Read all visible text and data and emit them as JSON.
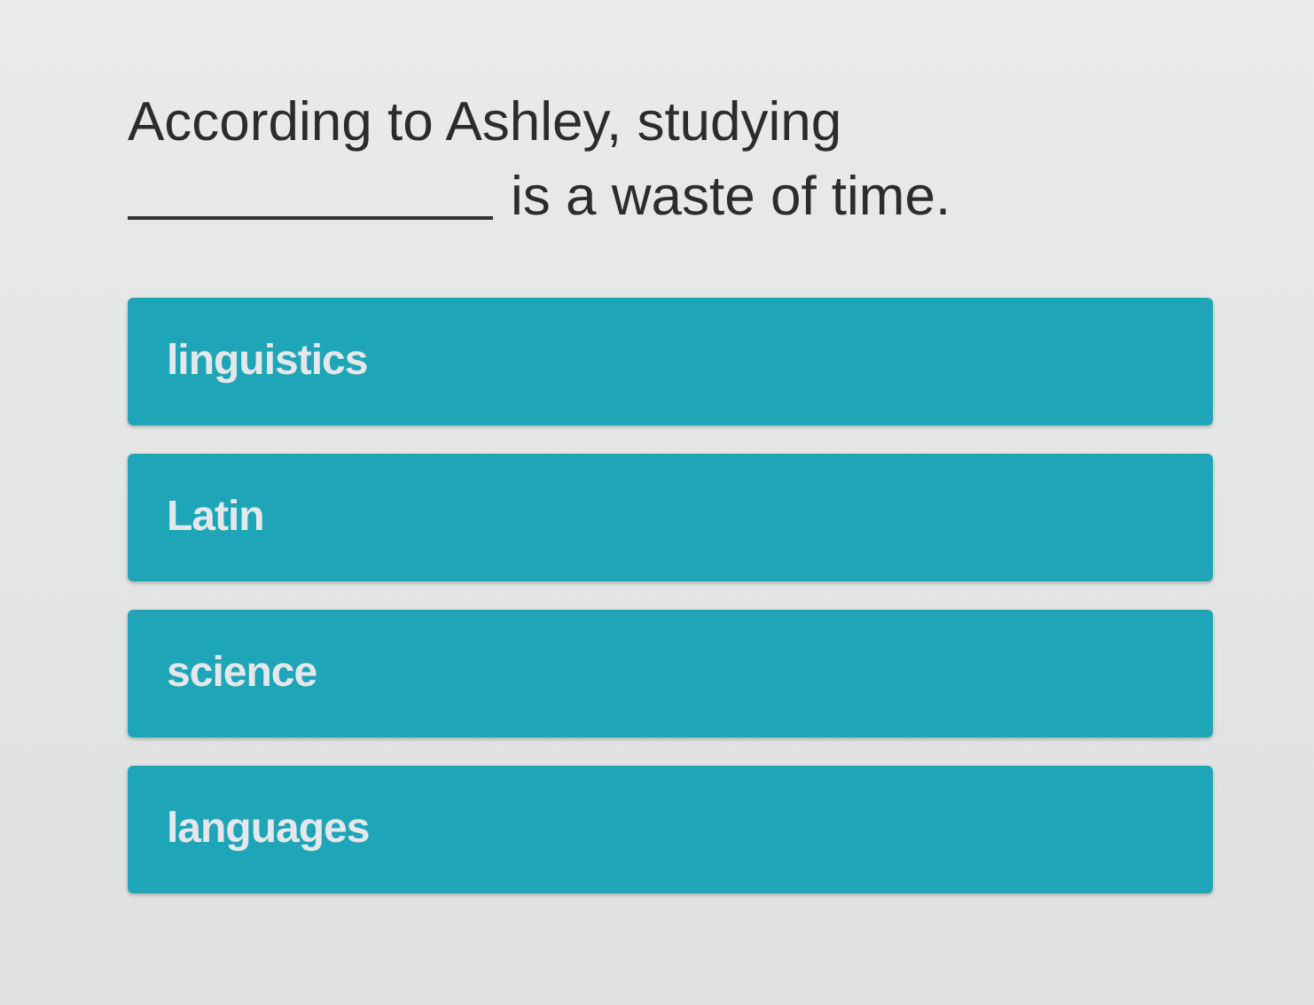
{
  "question": {
    "line_1": "According to Ashley, studying",
    "line_2": "is a waste of time."
  },
  "options": [
    {
      "label": "linguistics"
    },
    {
      "label": "Latin"
    },
    {
      "label": "science"
    },
    {
      "label": "languages"
    }
  ]
}
